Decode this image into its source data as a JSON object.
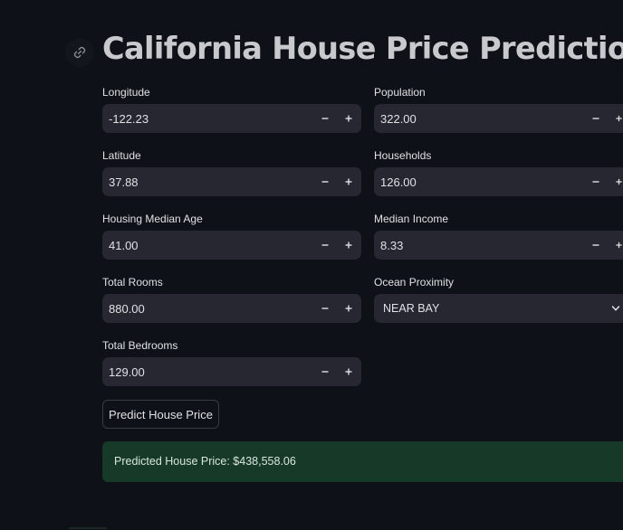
{
  "header": {
    "title": "California House Price Prediction",
    "anchor_icon": "link-icon"
  },
  "form": {
    "longitude": {
      "label": "Longitude",
      "value": "-122.23"
    },
    "latitude": {
      "label": "Latitude",
      "value": "37.88"
    },
    "housing_median_age": {
      "label": "Housing Median Age",
      "value": "41.00"
    },
    "total_rooms": {
      "label": "Total Rooms",
      "value": "880.00"
    },
    "total_bedrooms": {
      "label": "Total Bedrooms",
      "value": "129.00"
    },
    "population": {
      "label": "Population",
      "value": "322.00"
    },
    "households": {
      "label": "Households",
      "value": "126.00"
    },
    "median_income": {
      "label": "Median Income",
      "value": "8.33"
    },
    "ocean_proximity": {
      "label": "Ocean Proximity",
      "value": "NEAR BAY"
    }
  },
  "actions": {
    "predict_label": "Predict House Price"
  },
  "result": {
    "text": "Predicted House Price: $438,558.06"
  },
  "colors": {
    "background": "#0e1117",
    "input_background": "#262730",
    "success_background": "#173928",
    "title": "#c7c9cc"
  }
}
